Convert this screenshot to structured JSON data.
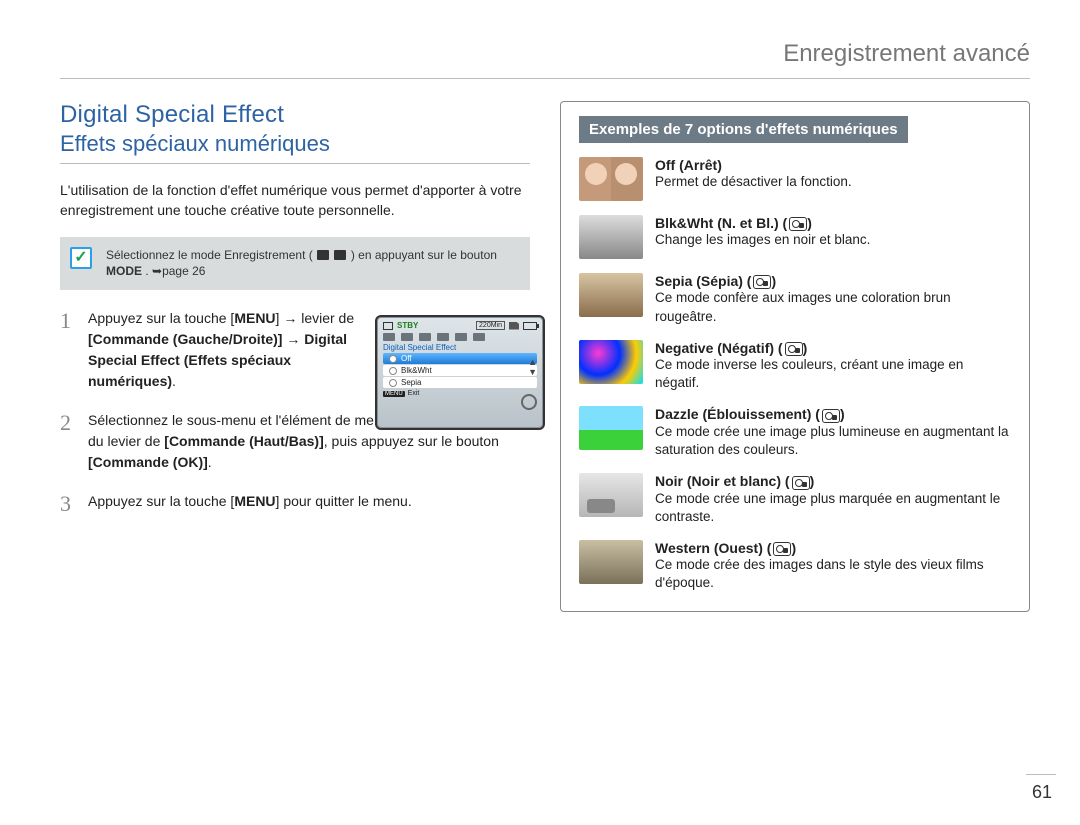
{
  "header": {
    "breadcrumb": "Enregistrement avancé"
  },
  "title": {
    "en": "Digital Special Effect",
    "fr": "Effets spéciaux numériques"
  },
  "intro": "L'utilisation de la fonction d'effet numérique vous permet d'apporter à votre enregistrement une touche créative toute personnelle.",
  "precheck": {
    "text_before": "Sélectionnez le mode Enregistrement (",
    "text_after": ") en appuyant sur le bouton ",
    "mode_label": "MODE",
    "page_ref": ". ➥page 26"
  },
  "steps": {
    "s1": {
      "num": "1",
      "line1a": "Appuyez sur la touche [",
      "menu": "MENU",
      "line1b": "] → levier de ",
      "cmd": "[Commande (Gauche/Droite)]",
      "arrow": " → ",
      "dse": "Digital Special Effect (Effets spéciaux numériques)",
      "end": "."
    },
    "s2": {
      "num": "2",
      "line1": "Sélectionnez le sous-menu et l'élément de menu de votre choix à l'aide du levier de ",
      "cmd": "[Commande (Haut/Bas)]",
      "mid": ", puis appuyez sur le bouton ",
      "ok": "[Commande (OK)]",
      "end": "."
    },
    "s3": {
      "num": "3",
      "line1": "Appuyez sur la touche [",
      "menu": "MENU",
      "line2": "] pour quitter le menu."
    }
  },
  "lcd": {
    "stby": "STBY",
    "time": "220Min",
    "menu_title": "Digital Special Effect",
    "opt_off": "Off",
    "opt_bw": "Blk&Wht",
    "opt_sepia": "Sepia",
    "exit_key": "MENU",
    "exit_label": "Exit"
  },
  "panel": {
    "title": "Exemples de 7 options d'effets numériques",
    "effects": {
      "off": {
        "name": "Off (Arrêt)",
        "desc": "Permet de désactiver la fonction."
      },
      "bw": {
        "name": "Blk&Wht (N. et Bl.)",
        "desc": "Change les images en noir et blanc."
      },
      "sepia": {
        "name": "Sepia (Sépia)",
        "desc": "Ce mode confère aux images une coloration brun rougeâtre."
      },
      "neg": {
        "name": "Negative (Négatif)",
        "desc": "Ce mode inverse les couleurs, créant une image en négatif."
      },
      "dazzle": {
        "name": "Dazzle (Éblouissement)",
        "desc": "Ce mode crée une image plus lumineuse en augmentant la saturation des couleurs."
      },
      "noir": {
        "name": "Noir (Noir et blanc)",
        "desc": "Ce mode crée une image plus marquée en augmentant le contraste."
      },
      "western": {
        "name": "Western (Ouest)",
        "desc": "Ce mode crée des images dans le style des vieux films d'époque."
      }
    }
  },
  "page_number": "61"
}
